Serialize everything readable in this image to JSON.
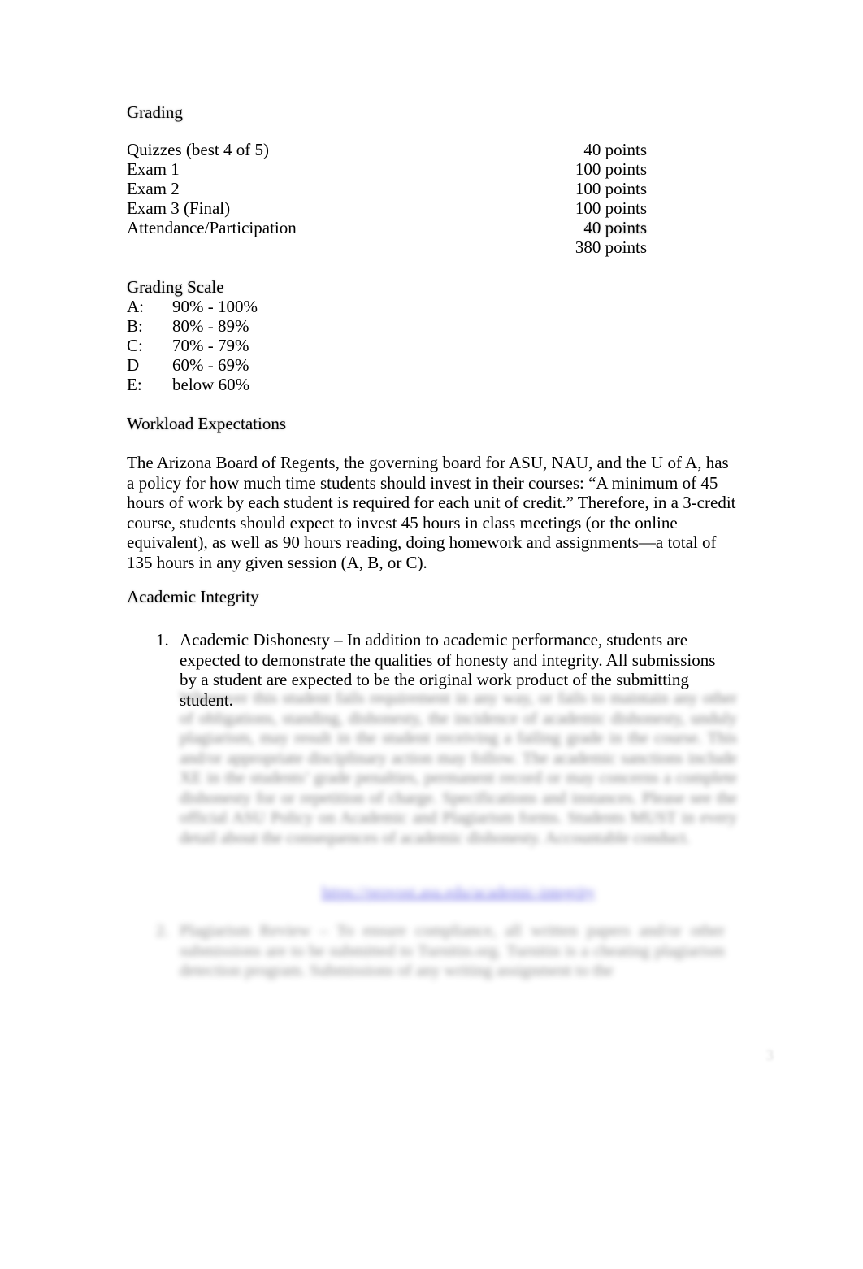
{
  "document": {
    "page_number": "3"
  },
  "grading": {
    "heading": "Grading",
    "rows": [
      {
        "item": "Quizzes (best 4 of 5)",
        "points": "40 points"
      },
      {
        "item": "Exam 1",
        "points": "100 points"
      },
      {
        "item": "Exam 2",
        "points": "100 points"
      },
      {
        "item": "Exam 3 (Final)",
        "points": "100 points"
      },
      {
        "item": "Attendance/Participation",
        "points": "40 points"
      }
    ],
    "total": "380 points"
  },
  "grading_scale": {
    "heading": "Grading Scale",
    "rows": [
      {
        "letter": "A:",
        "range": "90% - 100%"
      },
      {
        "letter": "B:",
        "range": "80% - 89%"
      },
      {
        "letter": "C:",
        "range": "70% - 79%"
      },
      {
        "letter": "D",
        "range": "60% - 69%"
      },
      {
        "letter": "E:",
        "range": "below 60%"
      }
    ]
  },
  "workload": {
    "heading": "Workload Expectations",
    "body": "The Arizona Board of Regents, the governing board for ASU, NAU, and the U of A, has a policy for how much time students should invest in their courses: “A minimum of 45 hours of work by each student is required for each unit of credit.” Therefore, in a 3-credit course, students should expect to invest 45 hours in class meetings (or the online equivalent), as well as 90 hours reading, doing homework and assignments—a total of 135 hours in any given session (A, B, or C)."
  },
  "academic_integrity": {
    "heading": "Academic Integrity",
    "items": [
      {
        "marker": "1.",
        "text": "Academic Dishonesty – In addition to academic performance, students are expected to demonstrate the qualities of honesty and integrity.  All submissions by a student are expected to be the original work product of the submitting student.",
        "redacted_continuation": "Whenever this student fails requirement in any way, or fails to maintain any other of obligations, standing, dishonesty, the incidence of academic dishonesty, unduly plagiarism, may result in the student receiving a failing grade in the course.  This and/or appropriate disciplinary action may follow.  The academic sanctions include XE in the students’ grade penalties, permanent record or may concerns a complete dishonesty for or repetition of charge.  Specifications and instances.  Please see the official ASU Policy on Academic and Plagiarism forms.  Students MUST in every detail about the consequences of academic dishonesty.  Accountable conduct.",
        "redacted_link": "https://provost.asu.edu/academic-integrity"
      },
      {
        "marker": "2.",
        "text_redacted": "Plagiarism Review – To ensure compliance, all written papers and/or other submissions are to be submitted to Turnitin.org.  Turnitin is a cheating plagiarism detection program.  Submissions of any writing assignment to the"
      }
    ]
  }
}
